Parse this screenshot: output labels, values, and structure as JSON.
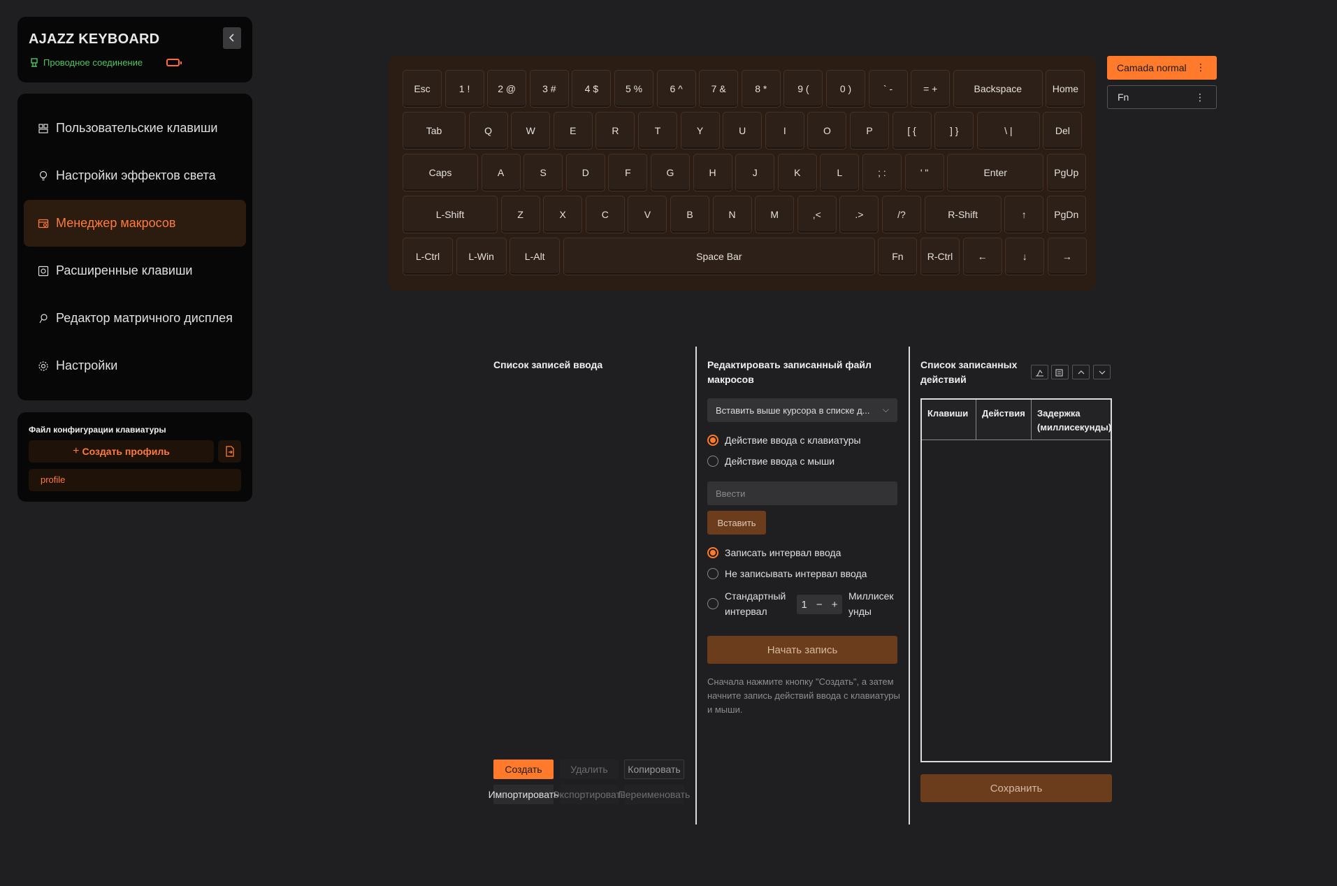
{
  "app": {
    "brand": "AJAZZ KEYBOARD",
    "connection": "Проводное соединение"
  },
  "sidebar": {
    "items": [
      {
        "label": "Пользовательские клавиши"
      },
      {
        "label": "Настройки эффектов света"
      },
      {
        "label": "Менеджер макросов"
      },
      {
        "label": "Расширенные клавиши"
      },
      {
        "label": "Редактор матричного дисплея"
      },
      {
        "label": "Настройки"
      }
    ],
    "active_index": 2
  },
  "config": {
    "title": "Файл конфигурации клавиатуры",
    "create_label": "Создать профиль",
    "profiles": [
      "profile"
    ]
  },
  "keyboard": {
    "rows": [
      [
        "Esc",
        "1 !",
        "2 @",
        "3 #",
        "4 $",
        "5 %",
        "6 ^",
        "7 &",
        "8 *",
        "9 (",
        "0 )",
        "` -",
        "= +",
        "Backspace",
        "Home"
      ],
      [
        "Tab",
        "Q",
        "W",
        "E",
        "R",
        "T",
        "Y",
        "U",
        "I",
        "O",
        "P",
        "[ {",
        "] }",
        "\\ |",
        "Del"
      ],
      [
        "Caps",
        "A",
        "S",
        "D",
        "F",
        "G",
        "H",
        "J",
        "K",
        "L",
        "; :",
        "' \"",
        "Enter",
        "PgUp"
      ],
      [
        "L-Shift",
        "Z",
        "X",
        "C",
        "V",
        "B",
        "N",
        "M",
        ",<",
        ".>",
        "/?",
        "R-Shift",
        "↑",
        "PgDn"
      ],
      [
        "L-Ctrl",
        "L-Win",
        "L-Alt",
        "Space Bar",
        "Fn",
        "R-Ctrl",
        "←",
        "↓",
        "→"
      ]
    ]
  },
  "layers": [
    {
      "label": "Camada normal",
      "active": true
    },
    {
      "label": "Fn",
      "active": false
    }
  ],
  "record_list": {
    "title": "Список записей ввода",
    "buttons": {
      "create": "Создать",
      "delete": "Удалить",
      "copy": "Копировать",
      "import": "Импортировать",
      "export": "Экспортировать",
      "rename": "Переименовать"
    }
  },
  "editor": {
    "title": "Редактировать записанный файл макросов",
    "insert_mode": "Вставить выше курсора в списке д...",
    "input_types": [
      {
        "label": "Действие ввода с клавиатуры",
        "selected": true
      },
      {
        "label": "Действие ввода с мыши",
        "selected": false
      }
    ],
    "input_placeholder": "Ввести",
    "insert_button": "Вставить",
    "interval_options": [
      {
        "label": "Записать интервал ввода",
        "selected": true
      },
      {
        "label": "Не записывать интервал ввода",
        "selected": false
      },
      {
        "label": "Стандартный интервал",
        "selected": false
      }
    ],
    "interval_value": "1",
    "interval_unit": "Миллисекунды",
    "start_button": "Начать запись",
    "hint": "Сначала нажмите кнопку \"Создать\", а затем начните запись действий ввода с клавиатуры и мыши."
  },
  "actions": {
    "title": "Список записанных действий",
    "columns": [
      "Клавиши",
      "Действия",
      "Задержка (миллисекунды)"
    ],
    "rows": [],
    "save_button": "Сохранить"
  },
  "colors": {
    "accent": "#ff7a2a",
    "connected": "#4cc661"
  }
}
